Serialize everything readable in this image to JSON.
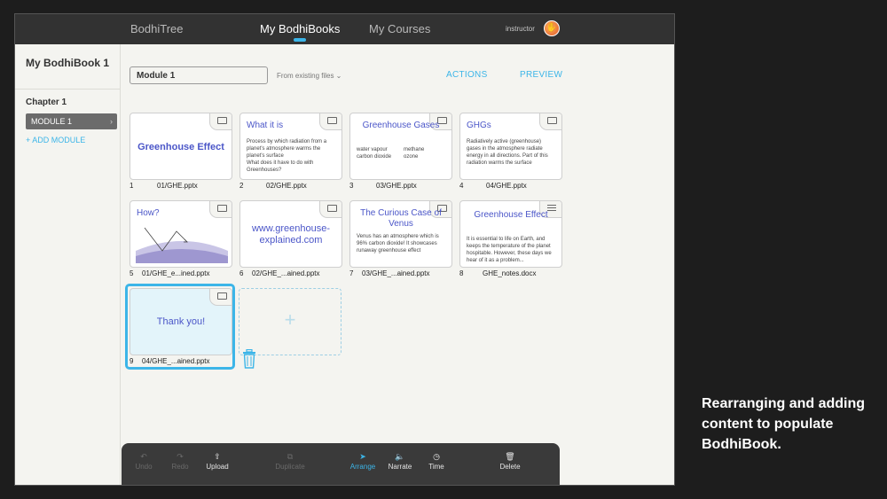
{
  "topbar": {
    "nav": [
      "BodhiTree",
      "My BodhiBooks",
      "My Courses"
    ],
    "user": "instructor",
    "avatar_glyph": "✋"
  },
  "sidebar": {
    "book_title": "My BodhiBook 1",
    "chapter": "Chapter 1",
    "module": "MODULE 1",
    "add_module": "+ ADD MODULE"
  },
  "main": {
    "module_name": "Module 1",
    "from_existing": "From existing files  ⌄",
    "actions": "ACTIONS",
    "preview": "PREVIEW"
  },
  "slides": [
    {
      "num": "1",
      "file": "01/GHE.pptx",
      "title": "Greenhouse Effect",
      "body": ""
    },
    {
      "num": "2",
      "file": "02/GHE.pptx",
      "title": "What it is",
      "body": "Process by which radiation from a planet's atmosphere warms the planet's surface\nWhat does it have to do with Greenhouses?"
    },
    {
      "num": "3",
      "file": "03/GHE.pptx",
      "title": "Greenhouse Gases",
      "col1": "water vapour\ncarbon dioxide",
      "col2": "methane\nozone"
    },
    {
      "num": "4",
      "file": "04/GHE.pptx",
      "title": "GHGs",
      "body": "Radiatively active (greenhouse) gases in the atmosphere radiate energy in all directions. Part of this radiation warms the surface"
    },
    {
      "num": "5",
      "file": "01/GHE_e...ined.pptx",
      "title": "How?",
      "body": ""
    },
    {
      "num": "6",
      "file": "02/GHE_...ained.pptx",
      "title": "www.greenhouse-explained.com",
      "body": ""
    },
    {
      "num": "7",
      "file": "03/GHE_...ained.pptx",
      "title": "The Curious Case of Venus",
      "body": "Venus has an atmosphere which is 96% carbon dioxide! It showcases runaway greenhouse effect"
    },
    {
      "num": "8",
      "file": "GHE_notes.docx",
      "title": "Greenhouse Effect",
      "body": "It is essential to life on Earth, and keeps the temperature of the planet hospitable. However, these days we hear of it as a problem..."
    },
    {
      "num": "9",
      "file": "04/GHE_...ained.pptx",
      "title": "Thank you!",
      "body": ""
    }
  ],
  "add_slot_label": "+",
  "toolbar": [
    "Undo",
    "Redo",
    "Upload",
    "Duplicate",
    "Arrange",
    "Narrate",
    "Time",
    "Delete"
  ],
  "toolbar_icons": [
    "↶",
    "↷",
    "⇧",
    "⧉",
    "➤",
    "🔈",
    "◷",
    "🗑"
  ],
  "caption": "Rearranging and adding content to populate BodhiBook.",
  "colors": {
    "accent": "#3cb5e8",
    "slide_title": "#4b56c8",
    "topbar": "#323232"
  }
}
